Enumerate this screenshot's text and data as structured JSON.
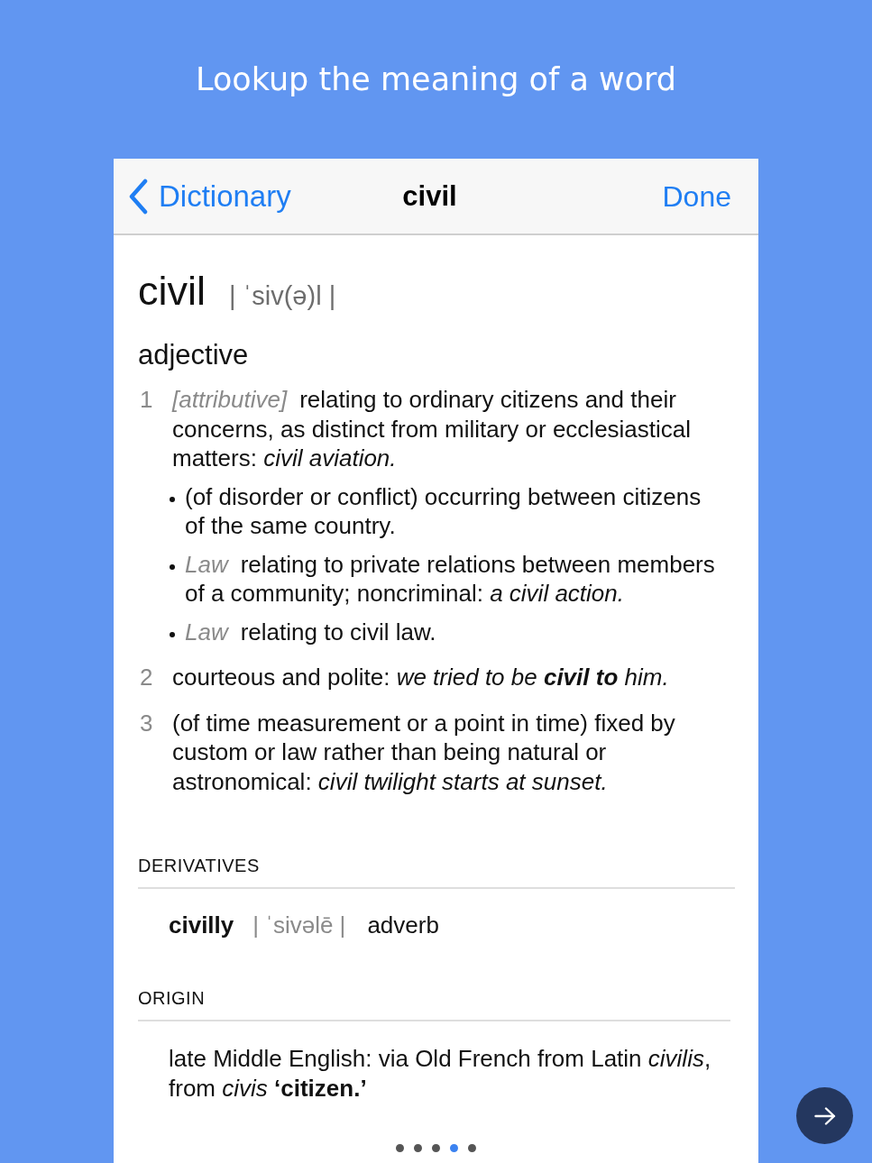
{
  "heading": "Lookup the meaning of a word",
  "nav_bar": {
    "back": "Dictionary",
    "title": "civil",
    "done": "Done"
  },
  "entry": {
    "headword": "civil",
    "pronunciation": "| ˈsiv(ə)l |",
    "part_of_speech": "adjective",
    "senses": [
      {
        "number": "1",
        "label": "[attributive]",
        "text": "relating to ordinary citizens and their concerns, as distinct from military or ecclesiastical matters:",
        "example": "civil aviation.",
        "subsenses": [
          {
            "text": "(of disorder or conflict) occurring between citizens of the same country."
          },
          {
            "label": "Law",
            "text": "relating to private relations between members of a community; noncriminal:",
            "example": "a civil action."
          },
          {
            "label": "Law",
            "text": "relating to civil law."
          }
        ]
      },
      {
        "number": "2",
        "text": "courteous and polite:",
        "example": "we tried to be **civil to** him."
      },
      {
        "number": "3",
        "text": "(of time measurement or a point in time) fixed by custom or law rather than being natural or astronomical:",
        "example": "civil twilight starts at sunset."
      }
    ]
  },
  "derivatives": {
    "title": "DERIVATIVES",
    "items": [
      {
        "word": "civilly",
        "pronunciation": "| ˈsivəlē |",
        "part_of_speech": "adverb"
      }
    ]
  },
  "origin": {
    "title": "ORIGIN",
    "text": "late Middle English: via Old French from Latin *civilis*, from *civis* **‘citizen.’**"
  },
  "page_dots": [
    {
      "selected": false
    },
    {
      "selected": false
    },
    {
      "selected": false
    },
    {
      "selected": true
    },
    {
      "selected": false
    }
  ]
}
